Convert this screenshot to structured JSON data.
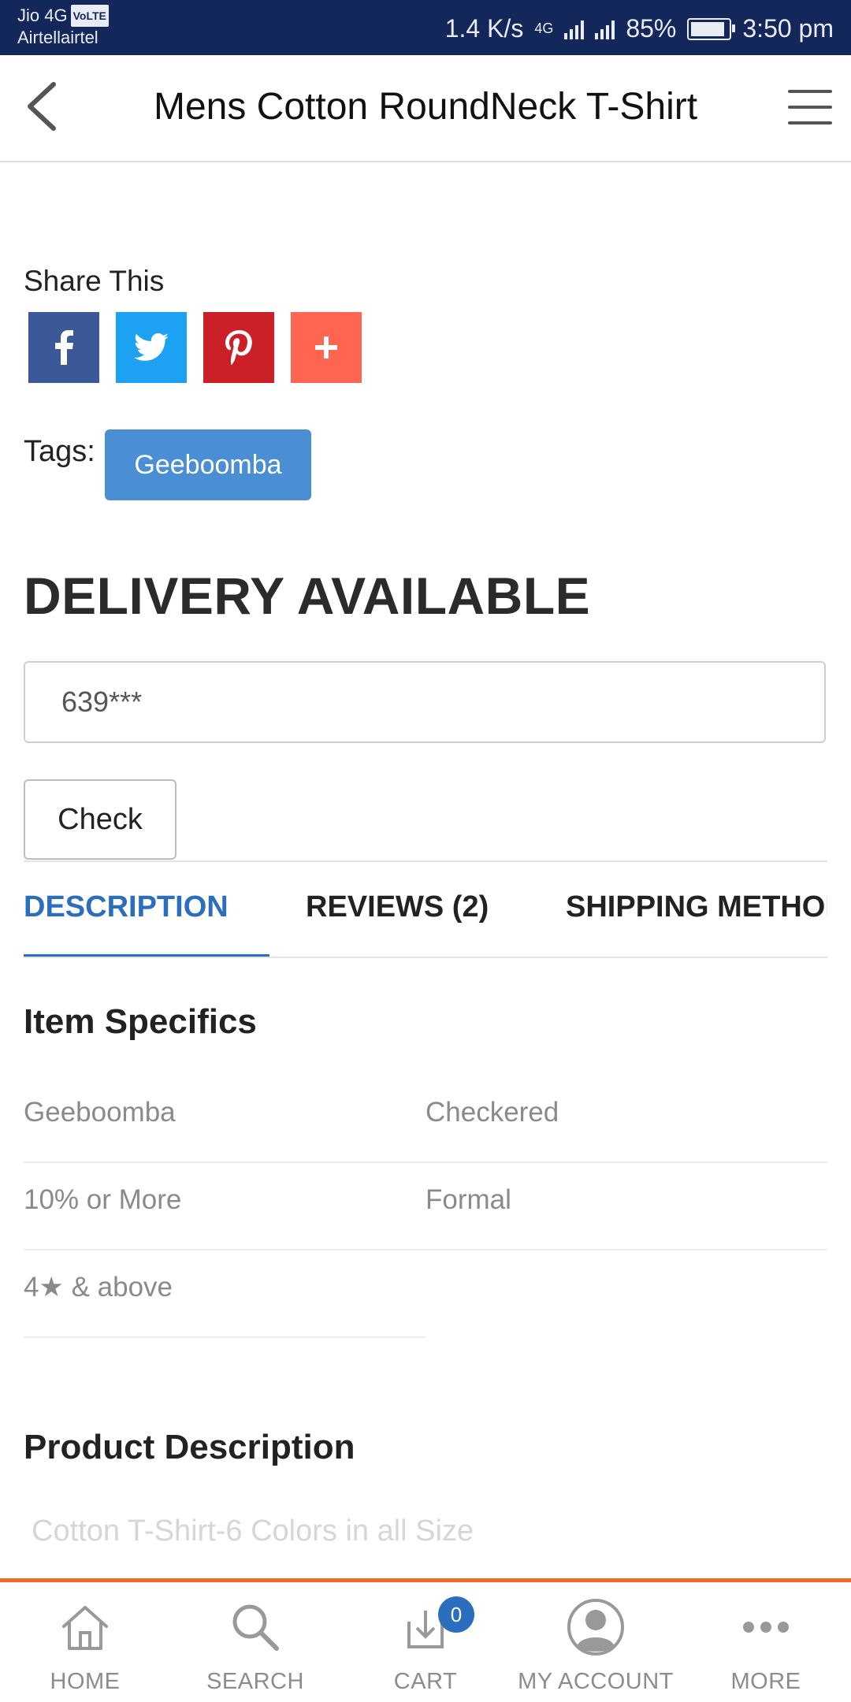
{
  "status_bar": {
    "carrier_line1": "Jio 4G",
    "volte": "VoLTE",
    "carrier_line2": "Airtellairtel",
    "speed": "1.4 K/s",
    "network_type": "4G",
    "battery": "85%",
    "time": "3:50 pm"
  },
  "header": {
    "title": "Mens Cotton RoundNeck T-Shirt",
    "back_icon": "chevron-left-icon",
    "menu_icon": "hamburger-icon"
  },
  "share": {
    "label": "Share This",
    "buttons": [
      {
        "name": "facebook",
        "color": "#3b5998"
      },
      {
        "name": "twitter",
        "color": "#1da1f2"
      },
      {
        "name": "pinterest",
        "color": "#cb2027"
      },
      {
        "name": "more",
        "color": "#ff6550"
      }
    ]
  },
  "tags": {
    "label": "Tags:",
    "items": [
      "Geeboomba"
    ]
  },
  "delivery": {
    "title": "DELIVERY AVAILABLE",
    "pincode_value": "639***",
    "check_label": "Check"
  },
  "tabs": [
    {
      "label": "DESCRIPTION",
      "active": true
    },
    {
      "label": "REVIEWS (2)",
      "active": false
    },
    {
      "label": "SHIPPING METHOD",
      "active": false
    }
  ],
  "item_specifics": {
    "title": "Item Specifics",
    "rows": [
      [
        "Geeboomba",
        "Checkered"
      ],
      [
        "10% or More",
        "Formal"
      ],
      [
        "4★ & above",
        ""
      ]
    ]
  },
  "product_description": {
    "title": "Product Description",
    "text": "Cotton T-Shirt-6 Colors in all Size"
  },
  "bottom_nav": {
    "items": [
      {
        "label": "HOME",
        "icon": "home-icon"
      },
      {
        "label": "SEARCH",
        "icon": "search-icon"
      },
      {
        "label": "CART",
        "icon": "cart-icon",
        "badge": "0"
      },
      {
        "label": "MY ACCOUNT",
        "icon": "account-icon"
      },
      {
        "label": "MORE",
        "icon": "more-icon"
      }
    ]
  },
  "colors": {
    "status_bar": "#14275a",
    "accent_blue": "#2a6ebd",
    "tag_blue": "#4a8fd4",
    "nav_border_orange": "#f16a1f"
  }
}
